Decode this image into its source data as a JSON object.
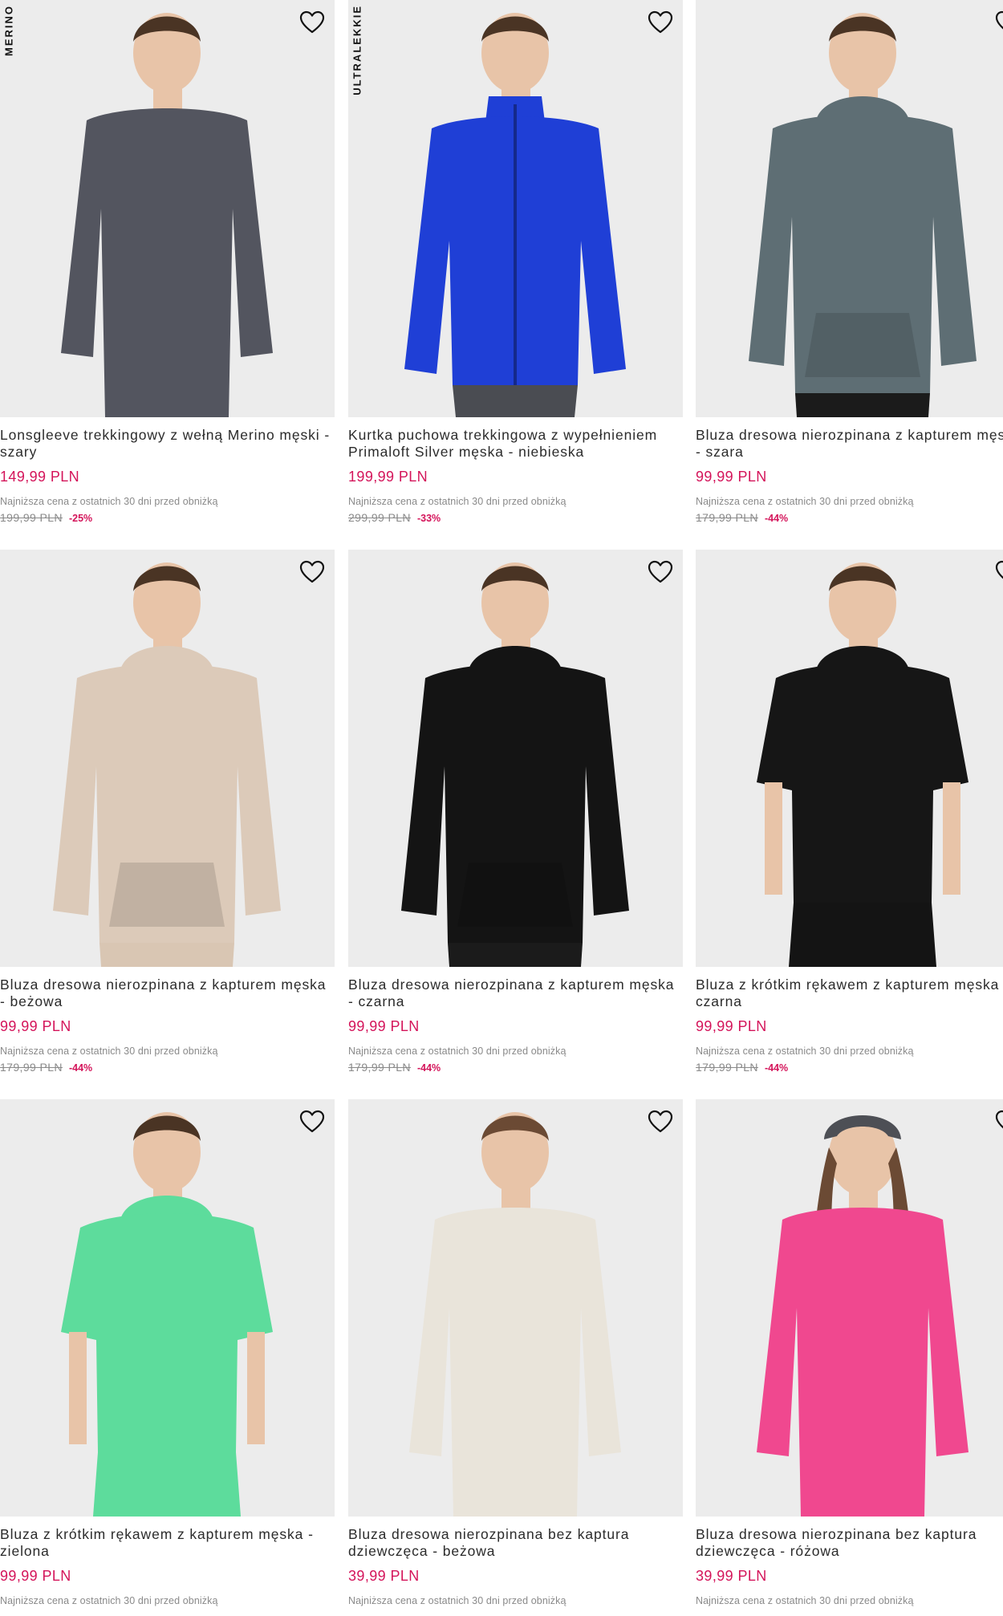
{
  "colors": {
    "price": "#d4145a",
    "discount": "#d4145a",
    "muted": "#8a8a8a",
    "photo_bg": "#ececec"
  },
  "products": [
    {
      "badge": "MERINO",
      "title": "Lonsgleeve trekkingowy z wełną Merino męski - szary",
      "price": "149,99 PLN",
      "note": "Najniższa cena z ostatnich 30 dni przed obniżką",
      "old_price": "199,99 PLN",
      "discount": "-25%",
      "garment_color": "#53555f",
      "icon": "heart-icon"
    },
    {
      "badge": "ULTRALEKKIE",
      "title": "Kurtka puchowa trekkingowa z wypełnieniem Primaloft Silver męska - niebieska",
      "price": "199,99 PLN",
      "note": "Najniższa cena z ostatnich 30 dni przed obniżką",
      "old_price": "299,99 PLN",
      "discount": "-33%",
      "garment_color": "#1f3fd6",
      "icon": "heart-icon"
    },
    {
      "badge": "",
      "title": "Bluza dresowa nierozpinana z kapturem męska - szara",
      "price": "99,99 PLN",
      "note": "Najniższa cena z ostatnich 30 dni przed obniżką",
      "old_price": "179,99 PLN",
      "discount": "-44%",
      "garment_color": "#5e6e74",
      "icon": "heart-icon"
    },
    {
      "badge": "",
      "title": "Bluza dresowa nierozpinana z kapturem męska - beżowa",
      "price": "99,99 PLN",
      "note": "Najniższa cena z ostatnich 30 dni przed obniżką",
      "old_price": "179,99 PLN",
      "discount": "-44%",
      "garment_color": "#dccab9",
      "icon": "heart-icon"
    },
    {
      "badge": "",
      "title": "Bluza dresowa nierozpinana z kapturem męska - czarna",
      "price": "99,99 PLN",
      "note": "Najniższa cena z ostatnich 30 dni przed obniżką",
      "old_price": "179,99 PLN",
      "discount": "-44%",
      "garment_color": "#141414",
      "icon": "heart-icon"
    },
    {
      "badge": "",
      "title": "Bluza z krótkim rękawem z kapturem męska - czarna",
      "price": "99,99 PLN",
      "note": "Najniższa cena z ostatnich 30 dni przed obniżką",
      "old_price": "179,99 PLN",
      "discount": "-44%",
      "garment_color": "#161616",
      "icon": "heart-icon"
    },
    {
      "badge": "",
      "title": "Bluza z krótkim rękawem z kapturem męska - zielona",
      "price": "99,99 PLN",
      "note": "Najniższa cena z ostatnich 30 dni przed obniżką",
      "old_price": "",
      "discount": "",
      "garment_color": "#5ddc9c",
      "icon": "heart-icon"
    },
    {
      "badge": "",
      "title": "Bluza dresowa nierozpinana bez kaptura dziewczęca - beżowa",
      "price": "39,99 PLN",
      "note": "Najniższa cena z ostatnich 30 dni przed obniżką",
      "old_price": "",
      "discount": "",
      "garment_color": "#e9e4da",
      "icon": "heart-icon"
    },
    {
      "badge": "",
      "title": "Bluza dresowa nierozpinana bez kaptura dziewczęca - różowa",
      "price": "39,99 PLN",
      "note": "Najniższa cena z ostatnich 30 dni przed obniżką",
      "old_price": "",
      "discount": "",
      "garment_color": "#f0488f",
      "icon": "heart-icon"
    }
  ]
}
